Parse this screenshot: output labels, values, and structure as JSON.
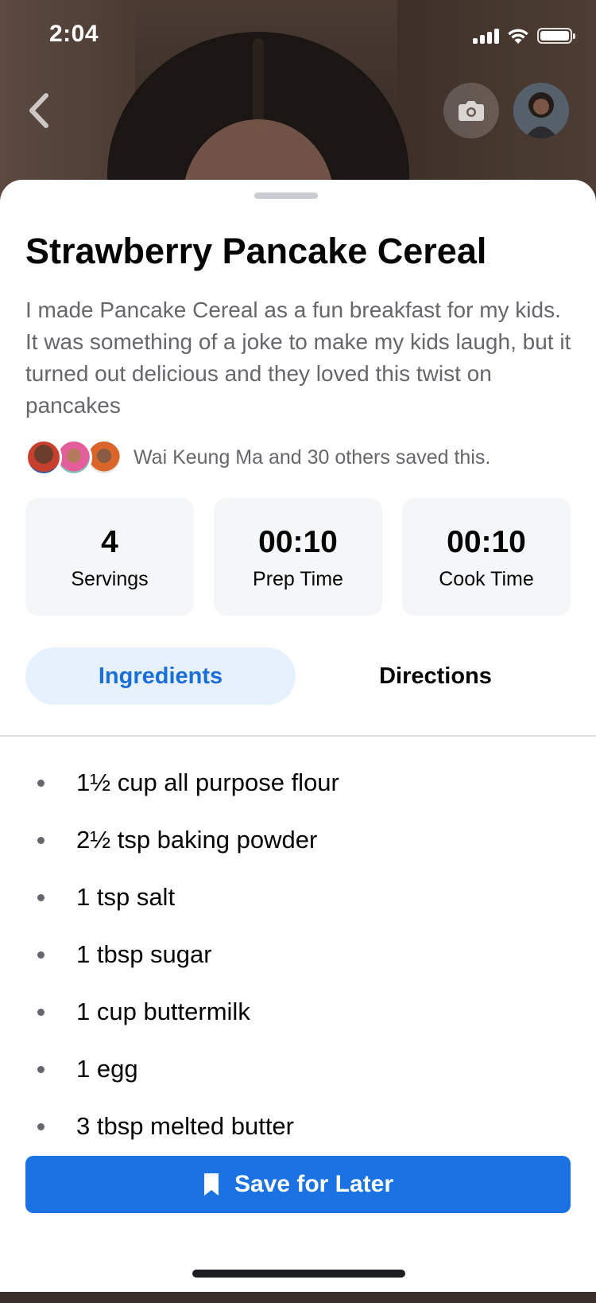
{
  "status_bar": {
    "time": "2:04"
  },
  "recipe": {
    "title": "Strawberry Pancake Cereal",
    "description": "I made Pancake Cereal as a fun breakfast for my kids. It was something of a joke to make my kids laugh, but it turned out delicious and they loved this twist on pancakes",
    "saved_by": "Wai Keung Ma and 30 others saved this."
  },
  "stats": [
    {
      "value": "4",
      "label": "Servings"
    },
    {
      "value": "00:10",
      "label": "Prep Time"
    },
    {
      "value": "00:10",
      "label": "Cook Time"
    }
  ],
  "tabs": {
    "ingredients": "Ingredients",
    "directions": "Directions",
    "active": "ingredients"
  },
  "ingredients": [
    "1½ cup all purpose flour",
    "2½ tsp baking powder",
    "1 tsp salt",
    "1 tbsp sugar",
    "1 cup buttermilk",
    "1 egg",
    "3 tbsp melted butter"
  ],
  "actions": {
    "save_label": "Save for Later"
  },
  "icons": {
    "back": "chevron-left-icon",
    "camera": "camera-icon",
    "bookmark": "bookmark-icon"
  },
  "colors": {
    "accent": "#1b72e3",
    "tab_active_bg": "#e7f1fd",
    "tab_active_text": "#1a6ed8"
  }
}
